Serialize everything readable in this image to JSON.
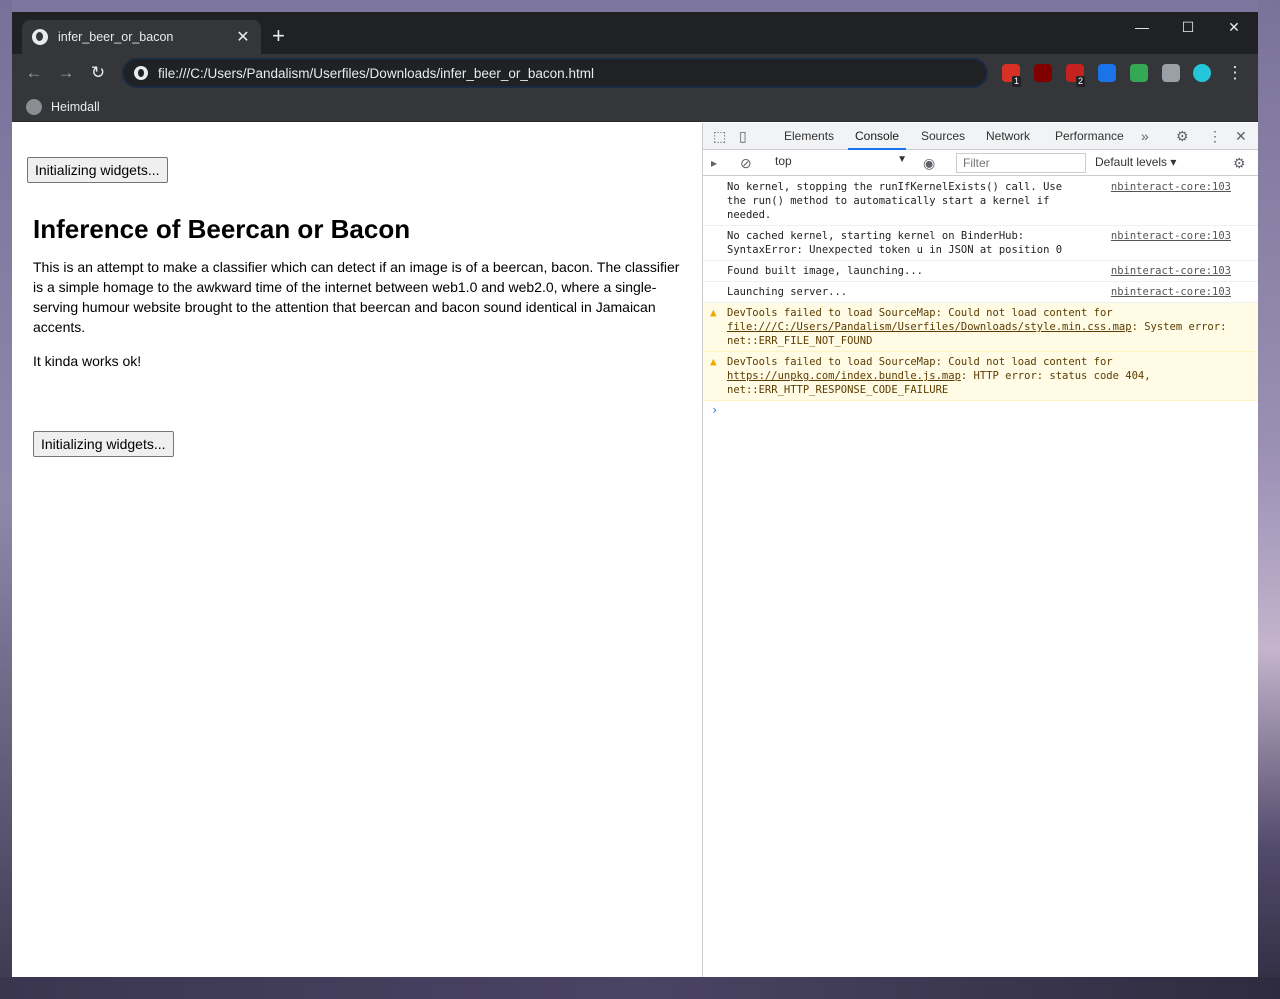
{
  "browser": {
    "tab_title": "infer_beer_or_bacon",
    "tab_close": "✕",
    "new_tab": "+",
    "url": "file:///C:/Users/Pandalism/Userfiles/Downloads/infer_beer_or_bacon.html",
    "bookmark": "Heimdall",
    "window_controls": {
      "minimize": "—",
      "maximize": "☐",
      "close": "✕"
    },
    "nav": {
      "back": "←",
      "forward": "→",
      "reload": "↻",
      "menu": "⋮"
    },
    "extensions": [
      {
        "name": "todo-extension-icon",
        "color": "#d93025",
        "badge": "1"
      },
      {
        "name": "ublock-origin-icon",
        "color": "#800000",
        "badge": ""
      },
      {
        "name": "extension-red-icon",
        "color": "#c5221f",
        "badge": "2"
      },
      {
        "name": "raindrop-icon",
        "color": "#1a73e8",
        "badge": ""
      },
      {
        "name": "pushbullet-icon",
        "color": "#34a853",
        "badge": ""
      },
      {
        "name": "puzzle-icon",
        "color": "#9aa0a6",
        "badge": ""
      },
      {
        "name": "profile-avatar-icon",
        "color": "#26c6da",
        "badge": ""
      }
    ]
  },
  "page": {
    "top_button": "Initializing widgets...",
    "heading": "Inference of Beercan or Bacon",
    "paragraph1": "This is an attempt to make a classifier which can detect if an image is of a beercan, bacon. The classifier is a simple homage to the awkward time of the internet between web1.0 and web2.0, where a single-serving humour website brought to the attention that beercan and bacon sound identical in Jamaican accents.",
    "paragraph2": "It kinda works ok!",
    "bottom_button": "Initializing widgets..."
  },
  "devtools": {
    "tabs": [
      "Elements",
      "Console",
      "Sources",
      "Network",
      "Performance"
    ],
    "active_tab": "Console",
    "more": "»",
    "context": "top",
    "filter_placeholder": "Filter",
    "levels": "Default levels ▾",
    "messages": [
      {
        "type": "log",
        "text": "No kernel, stopping the runIfKernelExists() call. Use\nthe run() method to automatically start a kernel if needed.",
        "source": "nbinteract-core:103"
      },
      {
        "type": "log",
        "text": "No cached kernel, starting kernel on BinderHub:\nSyntaxError: Unexpected token u in JSON at position 0",
        "source": "nbinteract-core:103"
      },
      {
        "type": "log",
        "text": "Found built image, launching...",
        "source": "nbinteract-core:103"
      },
      {
        "type": "log",
        "text": "Launching server...",
        "source": "nbinteract-core:103"
      }
    ],
    "warnings": [
      {
        "prefix": "DevTools failed to load SourceMap: Could not load content for ",
        "link": "file:///C:/Users/Pandalism/Userfiles/Downloads/style.min.css.map",
        "suffix": ": System error: net::ERR_FILE_NOT_FOUND"
      },
      {
        "prefix": "DevTools failed to load SourceMap: Could not load content for ",
        "link": "https://unpkg.com/index.bundle.js.map",
        "suffix": ": HTTP error: status code 404, net::ERR_HTTP_RESPONSE_CODE_FAILURE"
      }
    ],
    "prompt": "›"
  }
}
